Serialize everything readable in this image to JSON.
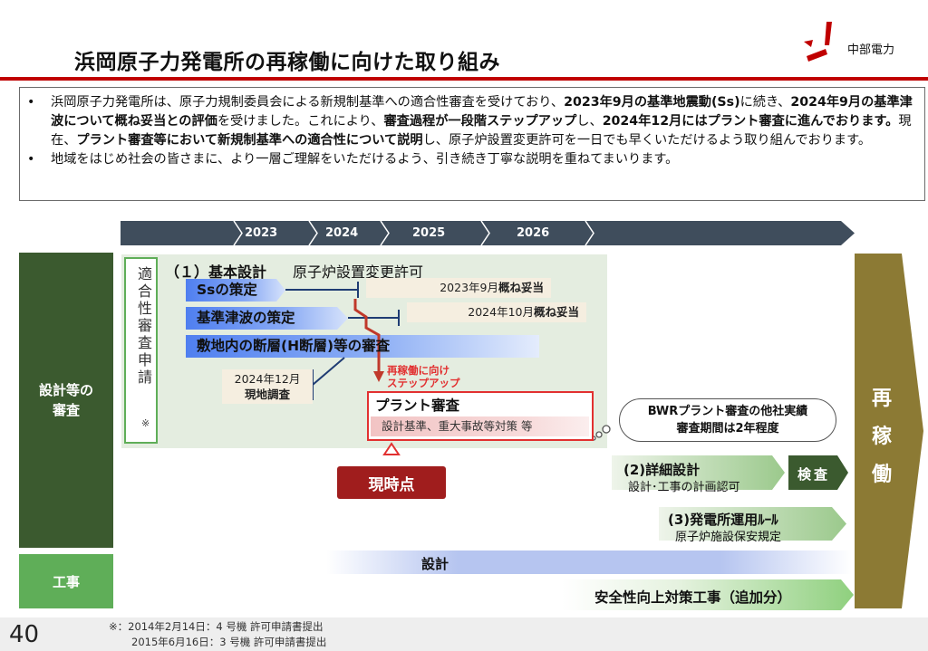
{
  "header": {
    "title": "浜岡原子力発電所の再稼働に向けた取り組み",
    "logo_text": "中部電力",
    "brand_color": "#c00000"
  },
  "intro": {
    "bullet1_parts": [
      {
        "t": "浜岡原子力発電所は、原子力規制委員会による新規制基準への適合性審査を受けており、",
        "b": false
      },
      {
        "t": "2023年9月の基準地震動(Ss)",
        "b": true
      },
      {
        "t": "に続き、",
        "b": false
      },
      {
        "t": "2024年9月の基準津波について概ね妥当との評価",
        "b": true
      },
      {
        "t": "を受けました。これにより、",
        "b": false
      },
      {
        "t": "審査過程が一段階ステップアップ",
        "b": true
      },
      {
        "t": "し、",
        "b": false
      },
      {
        "t": "2024年12月にはプラント審査に進んでおります。",
        "b": true
      },
      {
        "t": "現在、",
        "b": false
      },
      {
        "t": "プラント審査等において新規制基準への適合性について説明",
        "b": true
      },
      {
        "t": "し、原子炉設置変更許可を一日でも早くいただけるよう取り組んでおります。",
        "b": false
      }
    ],
    "bullet2": "地域をはじめ社会の皆さまに、より一層ご理解をいただけるよう、引き続き丁寧な説明を重ねてまいります。"
  },
  "timeline": {
    "years": [
      "2023",
      "2024",
      "2025",
      "2026"
    ]
  },
  "left_labels": {
    "design_review": "設計等の\n審査",
    "construction": "工事"
  },
  "application": {
    "label": "適合性審査申請",
    "note_mark": "※"
  },
  "basic_design": {
    "title": "（１）基本設計",
    "subtitle": "原子炉設置変更許可",
    "items": [
      "Ssの策定",
      "基準津波の策定",
      "敷地内の断層(H断層)等の審査"
    ],
    "notes": {
      "ss": {
        "date": "2023年9月",
        "result": "概ね妥当"
      },
      "tsunami": {
        "date": "2024年10月",
        "result": "概ね妥当"
      },
      "survey": {
        "line1": "2024年12月",
        "line2": "現地調査"
      }
    },
    "step_up": "再稼働に向け\nステップアップ",
    "plant_review": {
      "title": "プラント審査",
      "subtitle": "設計基準、重大事故等対策 等"
    }
  },
  "now_label": "現時点",
  "bwr_bubble": {
    "line1": "BWRプラント審査の他社実績",
    "line2": "審査期間は2年程度"
  },
  "detail_design": {
    "title": "(2)詳細設計",
    "subtitle": "設計･工事の計画認可"
  },
  "inspection": "検査",
  "operation_rules": {
    "title": "(3)発電所運用ﾙｰﾙ",
    "subtitle": "原子炉施設保安規定"
  },
  "restart": "再稼働",
  "construction": {
    "design": "設計",
    "safety": "安全性向上対策工事（追加分）"
  },
  "footer": {
    "page_number": "40",
    "footnote1": "※：2014年2月14日：4 号機 許可申請書提出",
    "footnote2": "2015年6月16日：3 号機 許可申請書提出"
  },
  "colors": {
    "dark_green": "#3b5a2f",
    "green": "#5fae58",
    "timeline": "#3f4d5c",
    "restart": "#8c7a34",
    "now": "#a01d1d",
    "alert": "#e23030"
  }
}
